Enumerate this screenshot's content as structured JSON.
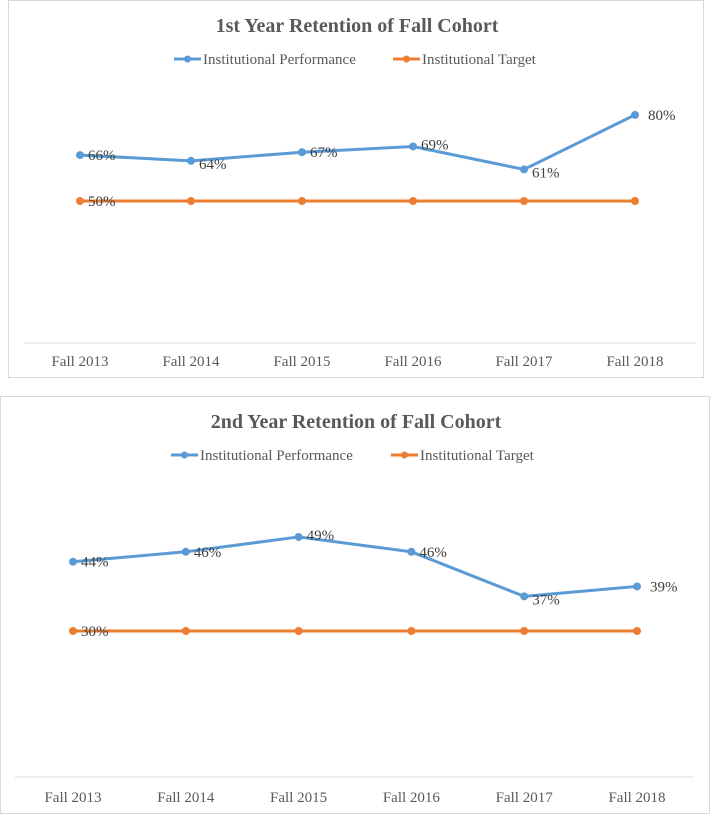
{
  "chart_data": [
    {
      "type": "line",
      "title": "1st Year Retention of Fall Cohort",
      "xlabel": "",
      "ylabel": "",
      "categories": [
        "Fall 2013",
        "Fall 2014",
        "Fall 2015",
        "Fall 2016",
        "Fall 2017",
        "Fall 2018"
      ],
      "series": [
        {
          "name": "Institutional Performance",
          "color": "#5b9bd5",
          "values": [
            66,
            64,
            67,
            69,
            61,
            80
          ],
          "labels": [
            "66%",
            "64%",
            "67%",
            "69%",
            "61%",
            "80%"
          ]
        },
        {
          "name": "Institutional Target",
          "color": "#ed7d31",
          "values": [
            50,
            50,
            50,
            50,
            50,
            50
          ],
          "labels": [
            "50%",
            "",
            "",
            "",
            "",
            ""
          ]
        }
      ],
      "legend": "top",
      "grid": false,
      "y_axis_visible": false
    },
    {
      "type": "line",
      "title": "2nd Year Retention of Fall Cohort",
      "xlabel": "",
      "ylabel": "",
      "categories": [
        "Fall 2013",
        "Fall 2014",
        "Fall 2015",
        "Fall 2016",
        "Fall 2017",
        "Fall 2018"
      ],
      "series": [
        {
          "name": "Institutional Performance",
          "color": "#5b9bd5",
          "values": [
            44,
            46,
            49,
            46,
            37,
            39
          ],
          "labels": [
            "44%",
            "46%",
            "49%",
            "46%",
            "37%",
            "39%"
          ]
        },
        {
          "name": "Institutional Target",
          "color": "#ed7d31",
          "values": [
            30,
            30,
            30,
            30,
            30,
            30
          ],
          "labels": [
            "30%",
            "",
            "",
            "",
            "",
            ""
          ]
        }
      ],
      "legend": "top",
      "grid": false,
      "y_axis_visible": false
    }
  ]
}
